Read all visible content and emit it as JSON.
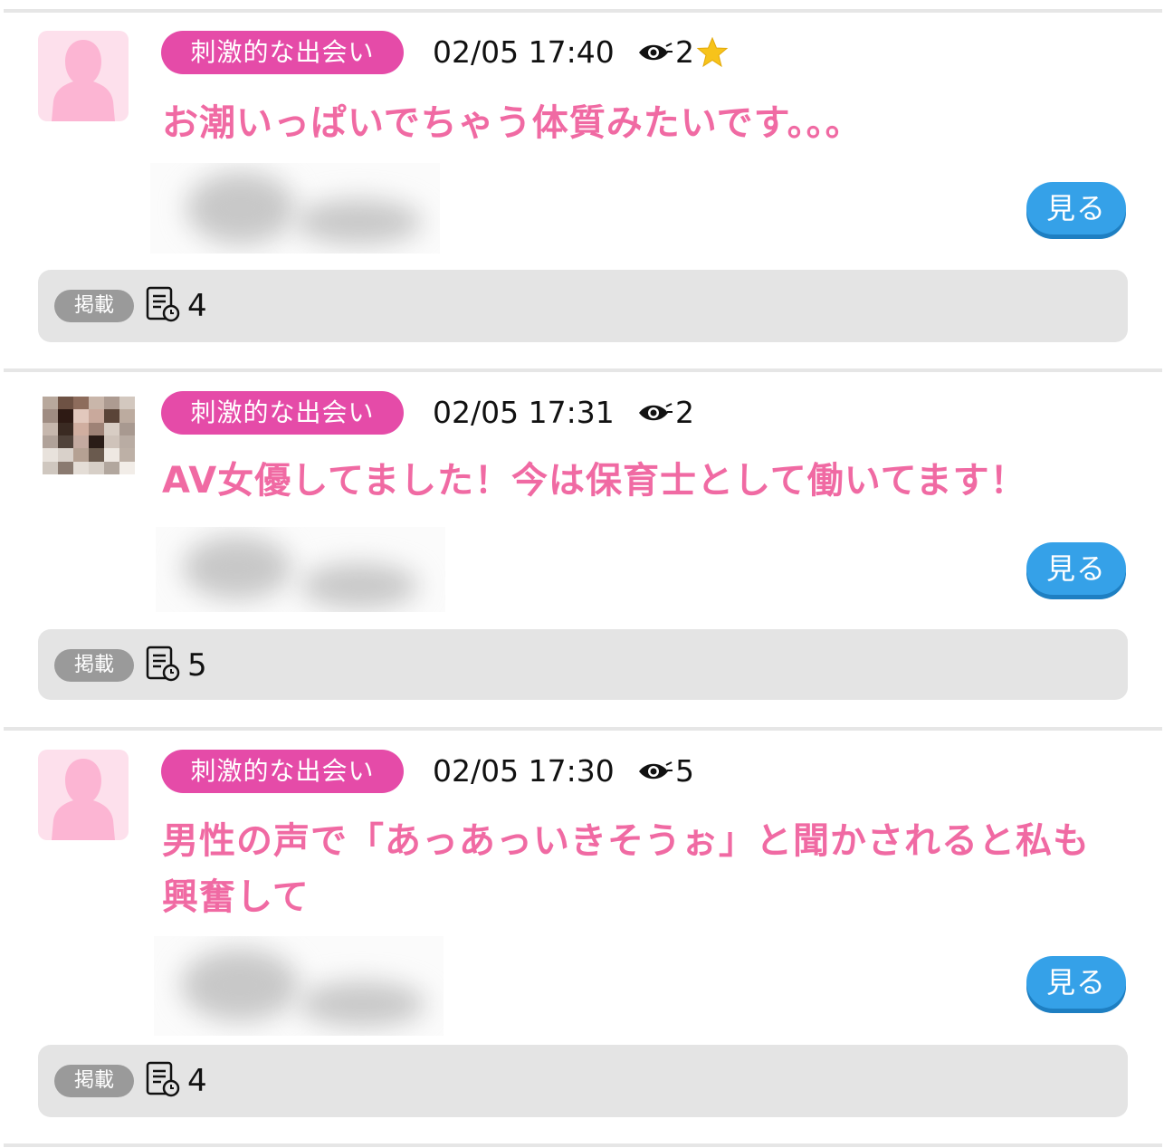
{
  "posts": [
    {
      "category": "刺激的な出会い",
      "timestamp": "02/05 17:40",
      "views": "2",
      "starred": true,
      "headline": "お潮いっぱいでちゃう体質みたいです。。。",
      "button_label": "見る",
      "footer_tag": "掲載",
      "footer_count": "4"
    },
    {
      "category": "刺激的な出会い",
      "timestamp": "02/05 17:31",
      "views": "2",
      "starred": false,
      "headline": "AV女優してました！今は保育士として働いてます！",
      "button_label": "見る",
      "footer_tag": "掲載",
      "footer_count": "5"
    },
    {
      "category": "刺激的な出会い",
      "timestamp": "02/05 17:30",
      "views": "5",
      "starred": false,
      "headline": "男性の声で「あっあっいきそうぉ」と聞かされると私も興奮して",
      "button_label": "見る",
      "footer_tag": "掲載",
      "footer_count": "4"
    }
  ],
  "icons": {
    "views": "eye-icon",
    "favorite": "star-icon",
    "posted": "document-clock-icon",
    "avatar": "female-silhouette-icon"
  },
  "colors": {
    "category_bg": "#e54ba8",
    "headline": "#f06aa3",
    "button_bg": "#35a1e8",
    "footer_bg": "#e4e4e4",
    "star": "#f7c31a"
  }
}
